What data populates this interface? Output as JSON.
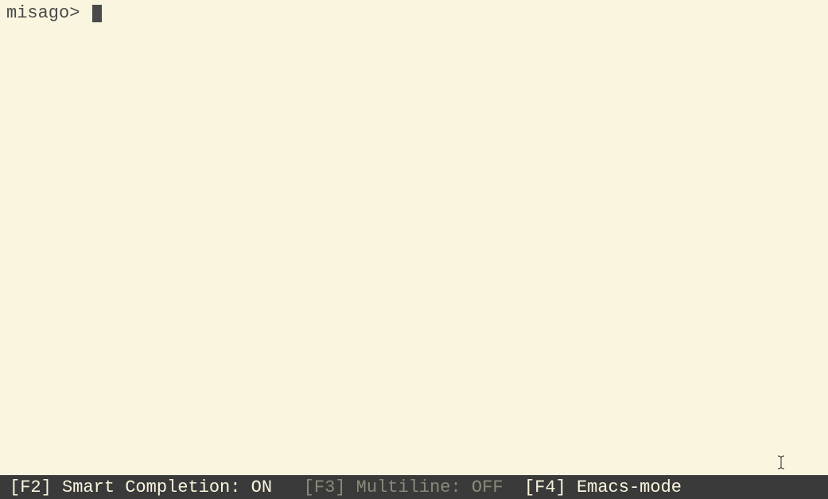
{
  "prompt": {
    "text": "misago> "
  },
  "statusbar": {
    "f2_key": "[F2]",
    "f2_label": " Smart Completion: ",
    "f2_value": "ON",
    "spacer1": "   ",
    "f3_key": "[F3]",
    "f3_label": " Multiline: ",
    "f3_value": "OFF",
    "spacer2": "  ",
    "f4_key": "[F4]",
    "f4_label": " Emacs-mode"
  }
}
